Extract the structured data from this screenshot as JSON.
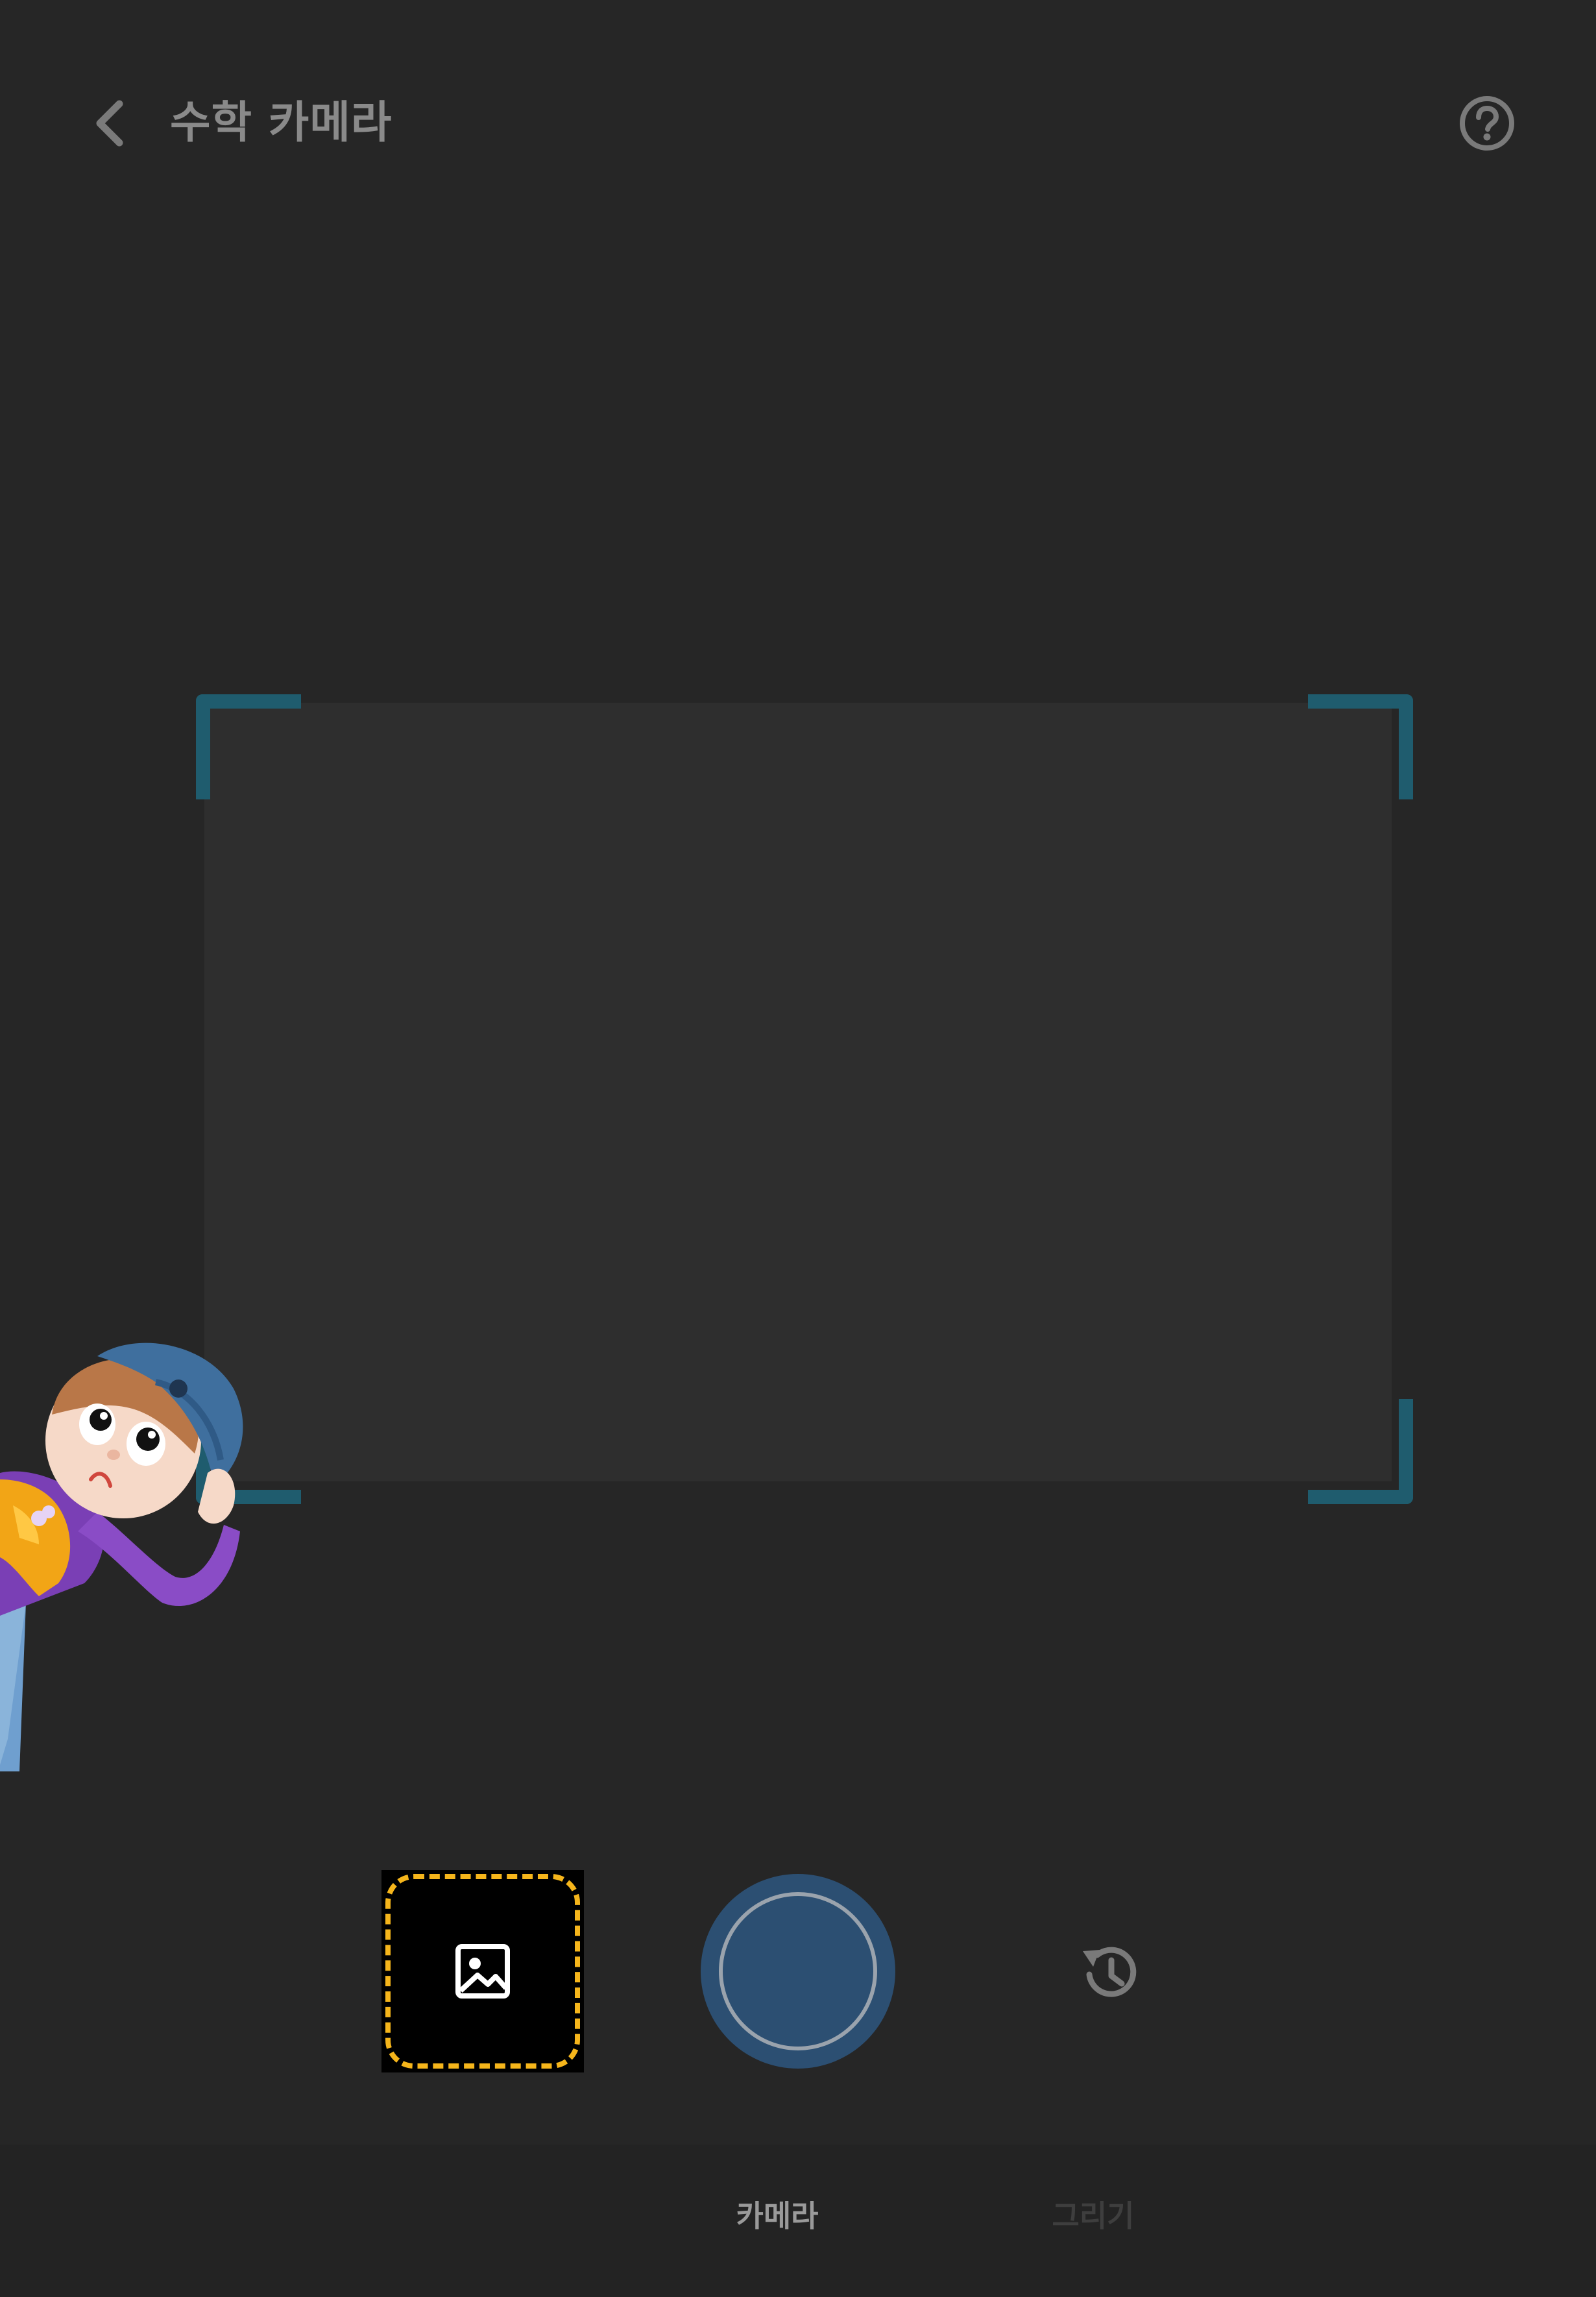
{
  "header": {
    "title": "수학 카메라",
    "back_icon": "chevron-left-icon",
    "help_icon": "question-circle-icon"
  },
  "scanner": {
    "corner_color": "#1f5c6e",
    "frame_color": "#2e2e2e"
  },
  "controls": {
    "gallery_icon": "image-icon",
    "gallery_highlight_color": "#f5b51b",
    "shutter_color": "#2c4f72",
    "history_icon": "history-icon"
  },
  "tabs": [
    {
      "label": "카메라",
      "active": true
    },
    {
      "label": "그리기",
      "active": false
    }
  ]
}
